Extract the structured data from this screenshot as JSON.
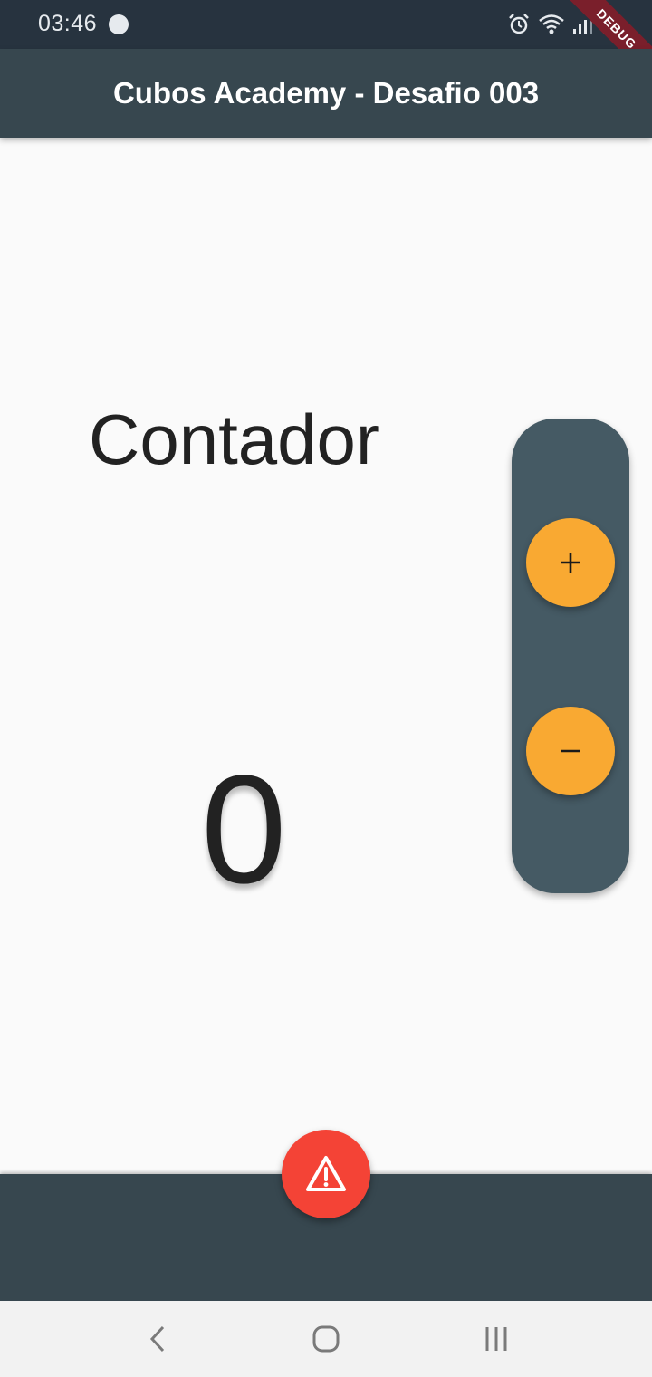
{
  "status_bar": {
    "time": "03:46"
  },
  "debug_banner": "DEBUG",
  "app_bar": {
    "title": "Cubos Academy - Desafio 003"
  },
  "main": {
    "label": "Contador",
    "counter_value": "0"
  },
  "controls": {
    "increment_icon": "plus-icon",
    "decrement_icon": "minus-icon"
  },
  "bottom_fab": {
    "icon": "warning-icon"
  },
  "colors": {
    "app_bar": "#37474f",
    "status_bar": "#27333f",
    "panel": "#455a64",
    "accent_orange": "#f9a932",
    "alert_red": "#f44336",
    "background": "#fafafa"
  },
  "nav_bar": {
    "icons": [
      "back-icon",
      "home-icon",
      "recents-icon"
    ]
  }
}
